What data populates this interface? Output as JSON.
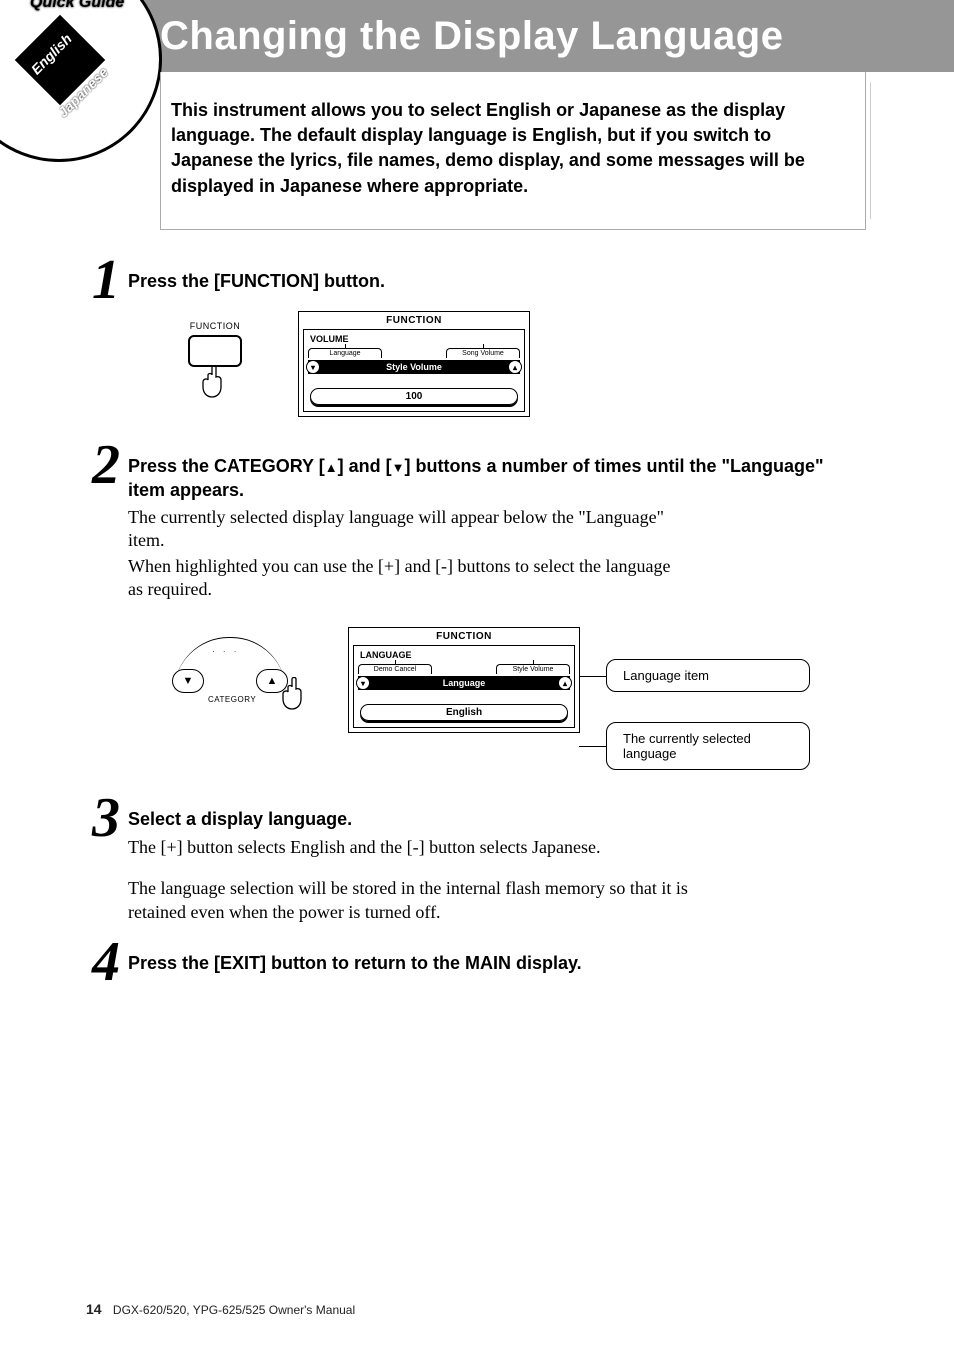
{
  "header": {
    "title": "Changing the Display Language"
  },
  "badge": {
    "tagline": "Quick Guide",
    "lang_a": "English",
    "lang_b": "Japanese"
  },
  "intro": "This instrument allows you to select English or Japanese as the display language. The default display language is English, but if you switch to Japanese the lyrics, file names, demo display, and some messages will be displayed in Japanese where appropriate.",
  "steps": {
    "s1": {
      "num": "1",
      "head": "Press the [FUNCTION] button.",
      "btn_label": "FUNCTION",
      "lcd": {
        "title": "FUNCTION",
        "category": "VOLUME",
        "tab_left": "Language",
        "tab_right": "Song Volume",
        "current_name": "Style Volume",
        "value": "100"
      }
    },
    "s2": {
      "num": "2",
      "head_a": "Press the CATEGORY [",
      "head_up": "▲",
      "head_mid": "] and [",
      "head_down": "▼",
      "head_b": "] buttons a number of times until the \"Language\" item appears.",
      "body_p1": "The currently selected display language will appear below the \"Language\" item.",
      "body_p2": "When highlighted you can use the [+] and [-] buttons to select the language as required.",
      "cat_label": "CATEGORY",
      "cat_up": "▲",
      "cat_down": "▼",
      "lcd": {
        "title": "FUNCTION",
        "category": "LANGUAGE",
        "tab_left": "Demo Cancel",
        "tab_right": "Style Volume",
        "current_name": "Language",
        "value": "English"
      },
      "callout_a": "Language item",
      "callout_b": "The currently selected language"
    },
    "s3": {
      "num": "3",
      "head": "Select a display language.",
      "body_p1": "The [+] button selects English and the [-] button selects Japanese.",
      "body_p2": "The language selection will be stored in the internal flash memory so that it is retained even when the power is turned off."
    },
    "s4": {
      "num": "4",
      "head": "Press the [EXIT] button to return to the MAIN display."
    }
  },
  "footer": {
    "page_num": "14",
    "doc": "DGX-620/520, YPG-625/525  Owner's Manual"
  }
}
